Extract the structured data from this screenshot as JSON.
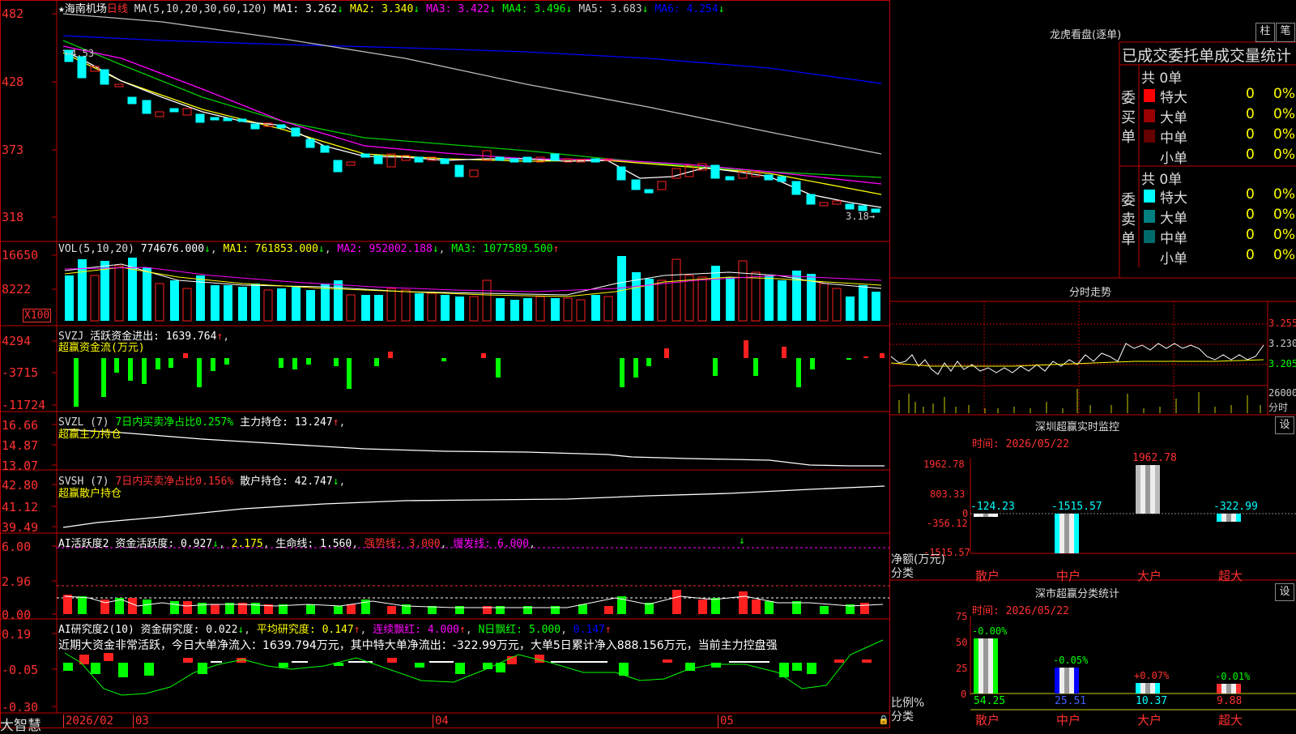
{
  "stock": {
    "name": "海南机场",
    "period": "日线",
    "ma_formula": "MA(5,10,20,30,60,120)",
    "ma": [
      {
        "label": "MA1:",
        "value": "3.262",
        "arrow": "↓",
        "color": "#ffffff"
      },
      {
        "label": "MA2:",
        "value": "3.340",
        "arrow": "↓",
        "color": "#ffff00"
      },
      {
        "label": "MA3:",
        "value": "3.422",
        "arrow": "↓",
        "color": "#ff00ff"
      },
      {
        "label": "MA4:",
        "value": "3.496",
        "arrow": "↓",
        "color": "#00ff00"
      },
      {
        "label": "MA5:",
        "value": "3.683",
        "arrow": "↓",
        "color": "#cccccc"
      },
      {
        "label": "MA6:",
        "value": "4.254",
        "arrow": "↓",
        "color": "#0000ff"
      }
    ],
    "y_ticks": [
      "482",
      "428",
      "373",
      "318"
    ],
    "high_label": "4.53",
    "low_label": "3.18"
  },
  "volume": {
    "header": "VOL(5,10,20)",
    "value": "774676.000",
    "ma1": "MA1: 761853.000",
    "ma2": "MA2: 952002.188",
    "ma3": "MA3: 1077589.500",
    "y_ticks": [
      "16650",
      "8222"
    ],
    "unit": "X100"
  },
  "svzj": {
    "header": "SVZJ",
    "label": "活跃资金进出:",
    "value": "1639.764",
    "subtitle": "超赢资金流(万元)",
    "y_ticks": [
      "4294",
      "-3715",
      "-11724"
    ]
  },
  "svzl": {
    "header": "SVZL (7)",
    "label1": "7日内买卖净占比0.257%",
    "label2": "主力持仓:",
    "value": "13.247",
    "subtitle": "超赢主力持仓",
    "y_ticks": [
      "16.66",
      "14.87",
      "13.07"
    ]
  },
  "svsh": {
    "header": "SVSH (7)",
    "label1": "7日内买卖净占比0.156%",
    "label2": "散户持仓:",
    "value": "42.747",
    "subtitle": "超赢散户持仓",
    "y_ticks": [
      "42.80",
      "41.12",
      "39.49"
    ]
  },
  "ai_active": {
    "header": "AI活跃度2",
    "label1": "资金活跃度:",
    "v1": "0.927",
    "v2": "2.175",
    "label3": "生命线:",
    "v3": "1.560",
    "label4": "强势线:",
    "v4": "3.000",
    "label5": "爆发线:",
    "v5": "6.000",
    "y_ticks": [
      "6.00",
      "2.96",
      "0.00"
    ]
  },
  "ai_research": {
    "header": "AI研究度2(10)",
    "label1": "资金研究度:",
    "v1": "0.022",
    "label2": "平均研究度:",
    "v2": "0.147",
    "label3": "连续飘红:",
    "v3": "4.000",
    "label4": "N日飘红:",
    "v4": "5.000",
    "v5": "0.147",
    "note": "近期大资金非常活跃，今日大单净流入：1639.794万元，其中特大单净流出：-322.99万元，大单5日累计净入888.156万元，当前主力控盘强",
    "y_ticks": [
      "0.19",
      "-0.05",
      "-0.30"
    ]
  },
  "x_axis": {
    "labels": [
      "2026/02",
      "03",
      "04",
      "05"
    ],
    "brand": "大智慧"
  },
  "longhu": {
    "title": "龙虎看盘(逐单)",
    "btn1": "柱",
    "btn2": "笔",
    "subtitle": "已成交委托单成交量统计",
    "buy_label": "委买单",
    "sell_label": "委卖单",
    "buy_total": "共 0单",
    "sell_total": "共 0单",
    "buy_rows": [
      {
        "name": "特大",
        "count": "0",
        "pct": "0%",
        "color": "#ff0000"
      },
      {
        "name": "大单",
        "count": "0",
        "pct": "0%",
        "color": "#990000"
      },
      {
        "name": "中单",
        "count": "0",
        "pct": "0%",
        "color": "#660000"
      },
      {
        "name": "小单",
        "count": "0",
        "pct": "0%",
        "color": "#000000"
      }
    ],
    "sell_rows": [
      {
        "name": "特大",
        "count": "0",
        "pct": "0%",
        "color": "#00ffff"
      },
      {
        "name": "大单",
        "count": "0",
        "pct": "0%",
        "color": "#008080"
      },
      {
        "name": "中单",
        "count": "0",
        "pct": "0%",
        "color": "#006b6b"
      },
      {
        "name": "小单",
        "count": "0",
        "pct": "0%",
        "color": "#000000"
      }
    ]
  },
  "intraday": {
    "title": "分时走势",
    "y_ticks": [
      "3.255",
      "3.230",
      "3.205"
    ],
    "vol_tick": "26000",
    "vol_unit": "分时"
  },
  "monitor": {
    "title": "深圳超赢实时监控",
    "btn": "设",
    "date": "时间: 2026/05/22",
    "y_ticks": [
      "1962.78",
      "803.33",
      "0",
      "-356.12",
      "-1515.57"
    ],
    "axis_title": "净额(万元)",
    "axis_sub": "分类"
  },
  "classify": {
    "title": "深市超赢分类统计",
    "btn": "设",
    "date": "时间: 2026/05/22",
    "y_ticks": [
      "75",
      "50",
      "25",
      "0"
    ],
    "axis_title": "比例%",
    "axis_sub": "分类"
  },
  "chart_data": [
    {
      "type": "bar",
      "title": "深圳超赢实时监控",
      "ylabel": "净额(万元)",
      "categories": [
        "散户",
        "中户",
        "大户",
        "超大"
      ],
      "values": [
        -124.23,
        -1515.57,
        1962.78,
        -322.99
      ],
      "value_labels": [
        "-124.23",
        "-1515.57",
        "1962.78",
        "-322.99"
      ],
      "ylim": [
        -1515.57,
        1962.78
      ]
    },
    {
      "type": "bar",
      "title": "深市超赢分类统计",
      "ylabel": "比例%",
      "categories": [
        "散户",
        "中户",
        "大户",
        "超大"
      ],
      "values": [
        54.25,
        25.51,
        10.37,
        9.88
      ],
      "value_labels": [
        "54.25",
        "25.51",
        "10.37",
        "9.88"
      ],
      "change_labels": [
        "-0.00%",
        "-0.05%",
        "+0.07%",
        "-0.01%"
      ],
      "ylim": [
        0,
        75
      ]
    }
  ]
}
